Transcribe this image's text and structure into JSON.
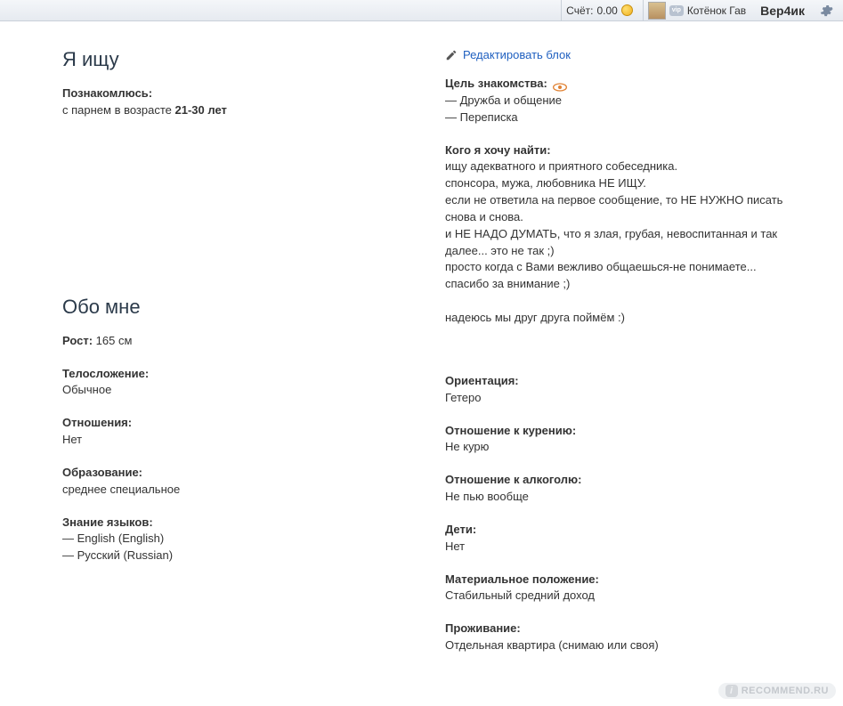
{
  "topbar": {
    "balance_label": "Счёт:",
    "balance_value": "0.00",
    "display_name": "Котёнок Гав",
    "username": "Вер4ик"
  },
  "looking_for": {
    "title": "Я ищу",
    "intro_label": "Познакомлюсь:",
    "intro_value_prefix": "с парнем в возрасте ",
    "intro_value_bold": "21-30 лет"
  },
  "edit_link": "Редактировать блок",
  "purpose": {
    "label": "Цель знакомства:",
    "items": [
      "Дружба и общение",
      "Переписка"
    ]
  },
  "want_find": {
    "label": "Кого я хочу найти:",
    "lines": [
      "ищу адекватного и приятного собеседника.",
      "спонсора, мужа, любовника НЕ ИЩУ.",
      "если не ответила на первое сообщение, то НЕ НУЖНО писать снова и снова.",
      "и НЕ НАДО ДУМАТЬ, что я злая, грубая, невоспитанная и так далее... это не так ;)",
      "просто когда с Вами вежливо общаешься-не понимаете...",
      "спасибо за внимание ;)",
      "",
      "надеюсь мы друг друга поймём :)"
    ]
  },
  "about": {
    "title": "Обо мне",
    "left_fields": [
      {
        "label": "Рост:",
        "value": "165 см",
        "inline": true
      },
      {
        "label": "Телосложение:",
        "value": "Обычное"
      },
      {
        "label": "Отношения:",
        "value": "Нет"
      },
      {
        "label": "Образование:",
        "value": "среднее специальное"
      }
    ],
    "lang_label": "Знание языков:",
    "lang_items": [
      "English (English)",
      "Русский (Russian)"
    ],
    "right_fields": [
      {
        "label": "Ориентация:",
        "value": "Гетеро"
      },
      {
        "label": "Отношение к курению:",
        "value": "Не курю"
      },
      {
        "label": "Отношение к алкоголю:",
        "value": "Не пью вообще"
      },
      {
        "label": "Дети:",
        "value": "Нет"
      },
      {
        "label": "Материальное положение:",
        "value": "Стабильный средний доход"
      },
      {
        "label": "Проживание:",
        "value": "Отдельная квартира (снимаю или своя)"
      }
    ]
  },
  "watermark": "RECOMMEND.RU"
}
